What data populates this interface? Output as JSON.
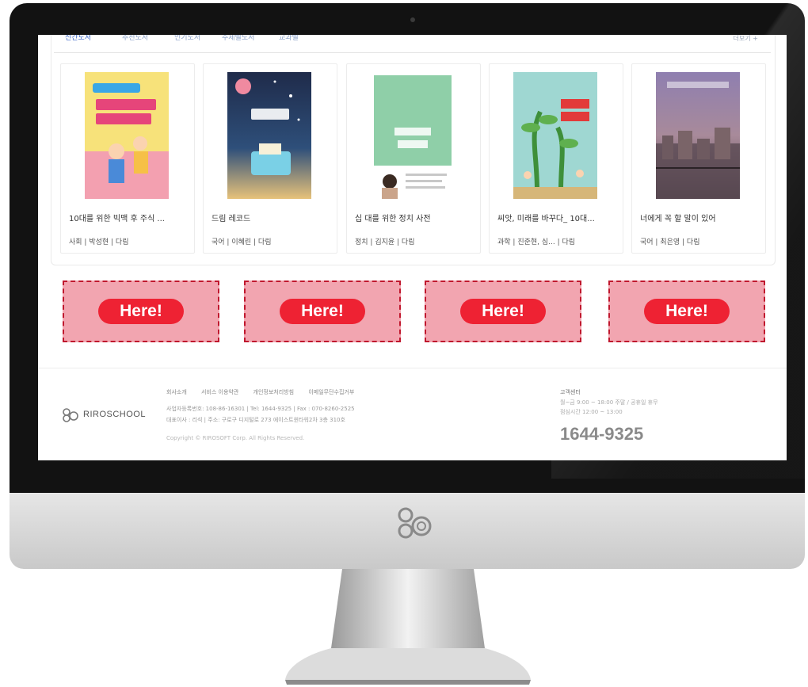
{
  "tabs": {
    "items": [
      "신간도서",
      "추천도서",
      "인기도서",
      "주제별도서",
      "교과별"
    ],
    "more": "더보기 +"
  },
  "books": [
    {
      "title": "10대를 위한 빅맥 후 주식 ...",
      "meta": "사회 | 박성현 | 다림",
      "cover_color": "#f7e27a"
    },
    {
      "title": "드림 레코드",
      "meta": "국어 | 이혜린 | 다림",
      "cover_color": "#2d3f63"
    },
    {
      "title": "십 대를 위한 정치 사전",
      "meta": "정치 | 김지윤 | 다림",
      "cover_color": "#8fcfa8"
    },
    {
      "title": "씨앗, 미래를 바꾸다_ 10대...",
      "meta": "과학 | 진준현, 심... | 다림",
      "cover_color": "#9fd7d2"
    },
    {
      "title": "너에게 꼭 할 말이 있어",
      "meta": "국어 | 최은영 | 다림",
      "cover_color": "#7b6f9a"
    }
  ],
  "slots": [
    {
      "label": "Here!"
    },
    {
      "label": "Here!"
    },
    {
      "label": "Here!"
    },
    {
      "label": "Here!"
    }
  ],
  "footer": {
    "brand": "RIROSCHOOL",
    "links": [
      "회사소개",
      "서비스 이용약관",
      "개인정보처리방침",
      "이메일무단수집거부"
    ],
    "info_line1": "사업자등록번호: 108-86-16301  |  Tel: 1644-9325  |  Fax : 070-8260-2525",
    "info_line2": "대표이사 : 리석  |  주소: 구로구 디지털로 273 에이스트윈타워2차 3층 310호",
    "copyright": "Copyright © RIROSOFT Corp. All Rights Reserved.",
    "cs_title": "고객센터",
    "cs_hours": "월~금 9:00 ~ 18:00 주말 / 공휴일 휴무",
    "cs_lunch": "점심시간 12:00 ~ 13:00",
    "cs_phone": "1644-9325"
  }
}
